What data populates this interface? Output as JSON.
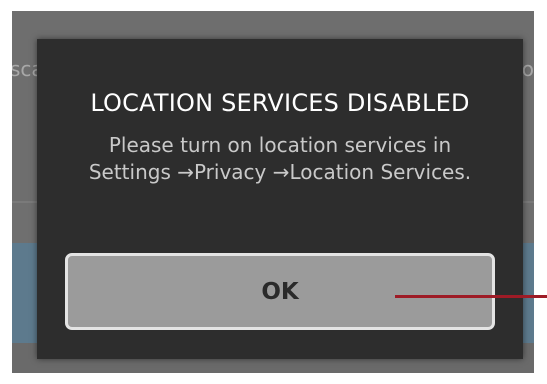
{
  "background": {
    "left_fragment": "sca",
    "right_fragment": "o"
  },
  "dialog": {
    "title": "LOCATION SERVICES DISABLED",
    "message": "Please turn on location services in Settings →Privacy →Location Services.",
    "ok_label": "OK"
  },
  "colors": {
    "dialog_bg": "#2d2d2d",
    "button_bg": "#9b9b9b",
    "button_border": "#e4e4e4",
    "callout": "#9e1b26",
    "band": "#5d7a8d"
  }
}
